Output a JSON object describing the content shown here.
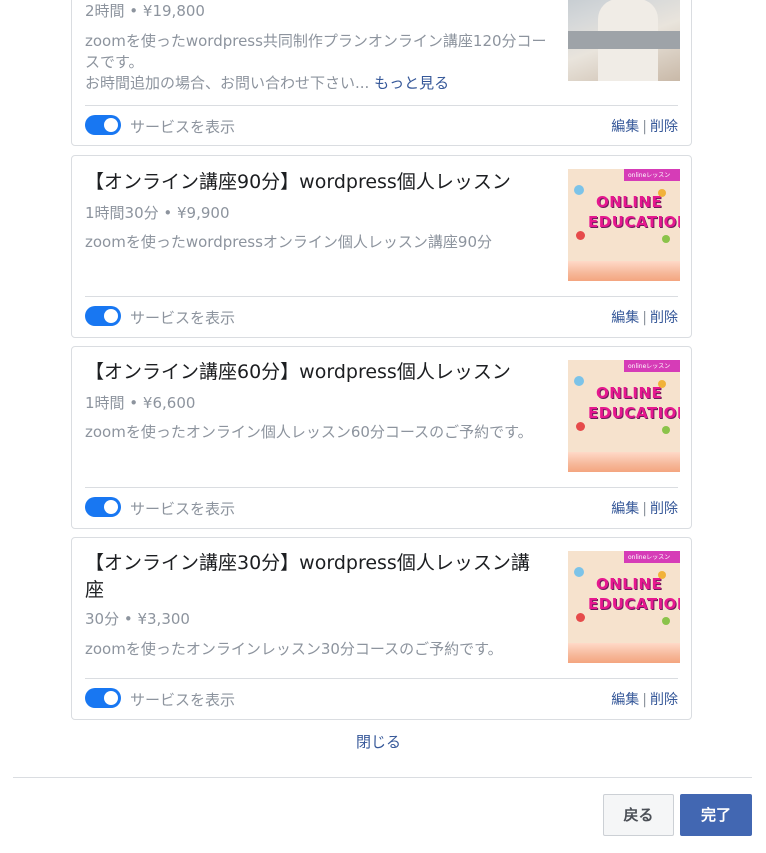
{
  "services": [
    {
      "title": "",
      "meta": "2時間 • ¥19,800",
      "desc_line1": "zoomを使ったwordpress共同制作プランオンライン講座120分コースです。",
      "desc_line2": "お時間追加の場合、お問い合わせ下さい...",
      "more_label": "もっと見る",
      "toggle_label": "サービスを表示",
      "edit_label": "編集",
      "sep": "|",
      "delete_label": "削除",
      "toggle_on": true,
      "image": "woman-laptop-photo"
    },
    {
      "title": "【オンライン講座90分】wordpress個人レッスン",
      "meta": "1時間30分 • ¥9,900",
      "desc": "zoomを使ったwordpressオンライン個人レッスン講座90分",
      "toggle_label": "サービスを表示",
      "edit_label": "編集",
      "sep": "|",
      "delete_label": "削除",
      "toggle_on": true,
      "image": "online-education-illustration"
    },
    {
      "title": "【オンライン講座60分】wordpress個人レッスン",
      "meta": "1時間 • ¥6,600",
      "desc": "zoomを使ったオンライン個人レッスン60分コースのご予約です。",
      "toggle_label": "サービスを表示",
      "edit_label": "編集",
      "sep": "|",
      "delete_label": "削除",
      "toggle_on": true,
      "image": "online-education-illustration"
    },
    {
      "title": "【オンライン講座30分】wordpress個人レッスン講座",
      "meta": "30分 • ¥3,300",
      "desc": "zoomを使ったオンラインレッスン30分コースのご予約です。",
      "toggle_label": "サービスを表示",
      "edit_label": "編集",
      "sep": "|",
      "delete_label": "削除",
      "toggle_on": true,
      "image": "online-education-illustration"
    }
  ],
  "edu_image": {
    "band_text": "onlineレッスン",
    "word1": "ONLINE",
    "word2": "EDUCATION"
  },
  "close_label": "閉じる",
  "footer": {
    "back_label": "戻る",
    "done_label": "完了"
  },
  "colors": {
    "toggle": "#1877f2",
    "link": "#365899",
    "primary_button": "#4267b2"
  }
}
